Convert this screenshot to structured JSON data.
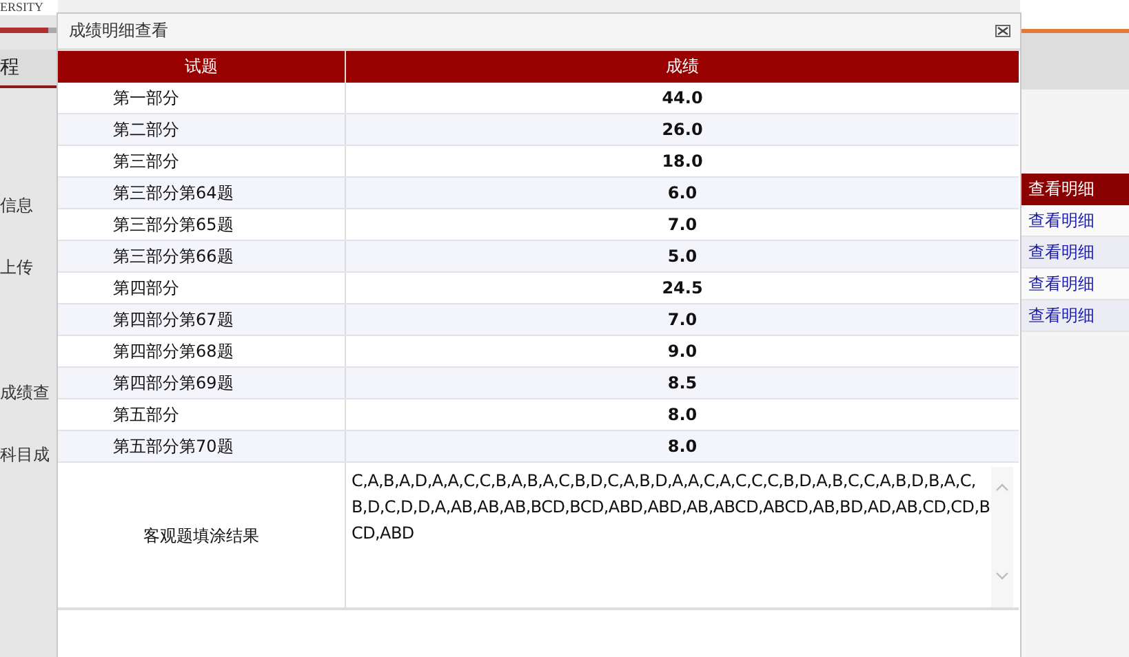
{
  "logo": {
    "text": "ERSITY"
  },
  "left_nav": {
    "tab": "程",
    "items": [
      "信息",
      "上传",
      "成绩查",
      "科目成"
    ]
  },
  "right_panel": {
    "header": "查看明细",
    "links": [
      "查看明细",
      "查看明细",
      "查看明细",
      "查看明细"
    ]
  },
  "dialog": {
    "title": "成绩明细查看",
    "columns": [
      "试题",
      "成绩"
    ],
    "rows": [
      {
        "item": "第一部分",
        "score": "44.0"
      },
      {
        "item": "第二部分",
        "score": "26.0"
      },
      {
        "item": "第三部分",
        "score": "18.0"
      },
      {
        "item": "第三部分第64题",
        "score": "6.0"
      },
      {
        "item": "第三部分第65题",
        "score": "7.0"
      },
      {
        "item": "第三部分第66题",
        "score": "5.0"
      },
      {
        "item": "第四部分",
        "score": "24.5"
      },
      {
        "item": "第四部分第67题",
        "score": "7.0"
      },
      {
        "item": "第四部分第68题",
        "score": "9.0"
      },
      {
        "item": "第四部分第69题",
        "score": "8.5"
      },
      {
        "item": "第五部分",
        "score": "8.0"
      },
      {
        "item": "第五部分第70题",
        "score": "8.0"
      }
    ],
    "answer_row": {
      "label": "客观题填涂结果",
      "value": "C,A,B,A,D,A,A,C,C,B,A,B,A,C,B,D,C,A,B,D,A,A,C,A,C,C,C,B,D,A,B,C,C,A,B,D,B,A,C,B,D,C,D,D,A,AB,AB,AB,BCD,BCD,ABD,ABD,AB,ABCD,ABCD,AB,BD,AD,AB,CD,CD,BCD,ABD"
    }
  }
}
